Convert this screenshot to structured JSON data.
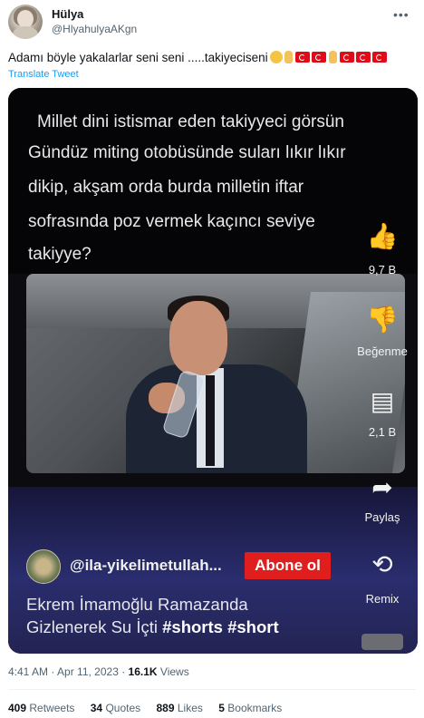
{
  "tweet": {
    "author_name": "Hülya",
    "author_handle": "@HlyahulyaAKgn",
    "more_icon": "more-icon",
    "text": "Adamı böyle yakalarlar seni seni .....takiyeciseni",
    "translate_label": "Translate Tweet",
    "time": "4:41 AM",
    "date": "Apr 11, 2023",
    "views_count": "16.1K",
    "views_label": "Views"
  },
  "media": {
    "caption_lines": [
      "Millet dini istismar eden takiyyeci görsün",
      "Gündüz miting otobüsünde suları lıkır lıkır",
      "dikip, akşam orda burda milletin iftar",
      "sofrasında poz vermek kaçıncı seviye",
      "takiyye?"
    ],
    "side_actions": {
      "like_count": "9,7 B",
      "dislike_label": "Beğenme",
      "comments_count": "2,1 B",
      "share_label": "Paylaş",
      "remix_label": "Remix"
    },
    "channel_name": "@ila-yikelimetullah...",
    "subscribe_label": "Abone ol",
    "video_title_line1": "Ekrem İmamoğlu Ramazanda",
    "video_title_line2_plain": "Gizlenerek Su İçti ",
    "video_title_tags": "#shorts #short"
  },
  "stats": {
    "retweets_count": "409",
    "retweets_label": "Retweets",
    "quotes_count": "34",
    "quotes_label": "Quotes",
    "likes_count": "889",
    "likes_label": "Likes",
    "bookmarks_count": "5",
    "bookmarks_label": "Bookmarks"
  },
  "colors": {
    "link": "#1d9bf0",
    "subscribe": "#e01e1e",
    "secondary_text": "#536471"
  }
}
